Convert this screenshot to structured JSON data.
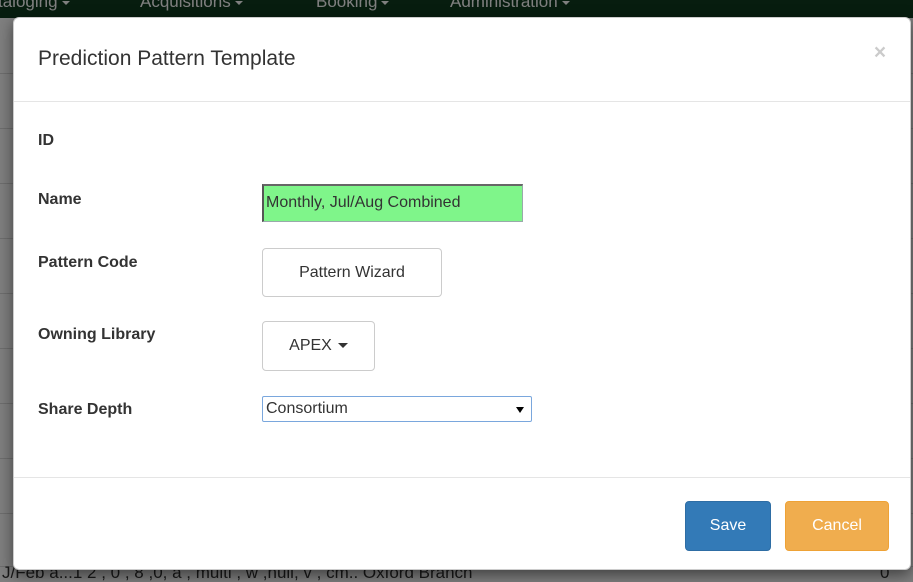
{
  "background": {
    "nav_items": [
      "taloging",
      "Acquisitions",
      "Booking",
      "Administration"
    ],
    "bottom_row_text": "J/Feb a...1 2 , 0 , 8 ,0, a , multi , w ,null, v , cm.. Oxford Branch",
    "bottom_row_count": "0"
  },
  "modal": {
    "title": "Prediction Pattern Template",
    "close_symbol": "×",
    "fields": {
      "id_label": "ID",
      "id_value": "",
      "name_label": "Name",
      "name_value": "Monthly, Jul/Aug Combined",
      "pattern_code_label": "Pattern Code",
      "pattern_wizard_label": "Pattern Wizard",
      "owning_library_label": "Owning Library",
      "owning_library_value": "APEX",
      "share_depth_label": "Share Depth",
      "share_depth_value": "Consortium"
    },
    "footer": {
      "save_label": "Save",
      "cancel_label": "Cancel"
    }
  },
  "colors": {
    "primary": "#337ab7",
    "warning": "#f0ad4e",
    "name_input_highlight": "#7ff58a",
    "navbar": "#0f3a1f"
  }
}
